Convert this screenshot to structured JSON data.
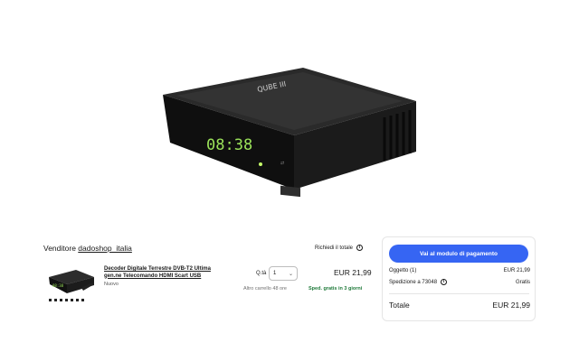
{
  "product_image": {
    "display_time": "08:38",
    "brand_mark": "QUBE III"
  },
  "cart": {
    "seller_prefix": "Venditore ",
    "seller_name": "dadoshop_italia",
    "request_total_label": "Richiedi il totale",
    "item": {
      "title": "Decoder Digitale Terrestre DVB-T2 Ultima gen.ne Telecomando HDMI Scart USB",
      "condition": "Nuovo",
      "qty_label": "Q.tà",
      "qty_value": "1",
      "other_buyers": "Altro carrello 48 ore",
      "price": "EUR 21,99",
      "shipping": "Sped. gratis in 3 giorni"
    }
  },
  "summary": {
    "pay_button_label": "Vai al modulo di pagamento",
    "item_label": "Oggetto (1)",
    "item_value": "EUR 21,99",
    "shipping_label": "Spedizione a 73048",
    "shipping_value": "Gratis",
    "total_label": "Totale",
    "total_value": "EUR 21,99"
  },
  "colors": {
    "accent": "#3665f3",
    "shipping_green": "#1f7a3a",
    "display_green": "#9be35a"
  }
}
